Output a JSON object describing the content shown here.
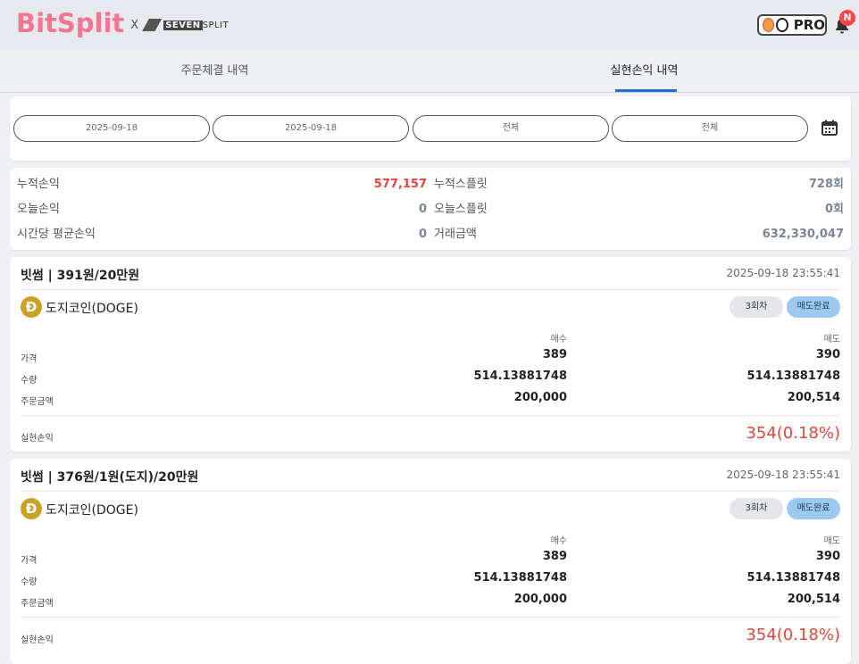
{
  "header": {
    "logo_main": "BitSplit",
    "logo_x": "X",
    "partner_prefix": "SEVEN",
    "partner_suffix": "SPLIT",
    "pro_label": "PRO",
    "notification_badge": "N"
  },
  "tabs": [
    {
      "label": "주문체결 내역",
      "active": false
    },
    {
      "label": "실현손익 내역",
      "active": true
    }
  ],
  "filters": {
    "start_date": "2025-09-18",
    "end_date": "2025-09-18",
    "filter1": "전체",
    "filter2": "전체"
  },
  "summary": {
    "cumulative_pnl_label": "누적손익",
    "cumulative_pnl": "577,157",
    "cumulative_split_label": "누적스플릿",
    "cumulative_split": "728회",
    "today_pnl_label": "오늘손익",
    "today_pnl": "0",
    "today_split_label": "오늘스플릿",
    "today_split": "0회",
    "hourly_avg_label": "시간당 평균손익",
    "hourly_avg": "0",
    "trade_amount_label": "거래금액",
    "trade_amount": "632,330,047"
  },
  "trades": [
    {
      "title": "빗썸 | 391원/20만원",
      "time": "2025-09-18 23:55:41",
      "coin_symbol": "Ð",
      "coin_name": "도지코인(DOGE)",
      "round": "3회차",
      "status": "매도완료",
      "buy_header": "매수",
      "sell_header": "매도",
      "price_label": "가격",
      "qty_label": "수량",
      "amount_label": "주문금액",
      "buy_price": "389",
      "sell_price": "390",
      "buy_qty": "514.13881748",
      "sell_qty": "514.13881748",
      "buy_amount": "200,000",
      "sell_amount": "200,514",
      "pnl_label": "실현손익",
      "pnl": "354(0.18%)"
    },
    {
      "title": "빗썸 | 376원/1원(도지)/20만원",
      "time": "2025-09-18 23:55:41",
      "coin_symbol": "Ð",
      "coin_name": "도지코인(DOGE)",
      "round": "3회차",
      "status": "매도완료",
      "buy_header": "매수",
      "sell_header": "매도",
      "price_label": "가격",
      "qty_label": "수량",
      "amount_label": "주문금액",
      "buy_price": "389",
      "sell_price": "390",
      "buy_qty": "514.13881748",
      "sell_qty": "514.13881748",
      "buy_amount": "200,000",
      "sell_amount": "200,514",
      "pnl_label": "실현손익",
      "pnl": "354(0.18%)"
    }
  ],
  "colors": {
    "logo": "#f5748f",
    "accent": "#1f6fd6",
    "profit": "#e8443a",
    "badge_done": "#9cc9f0"
  }
}
